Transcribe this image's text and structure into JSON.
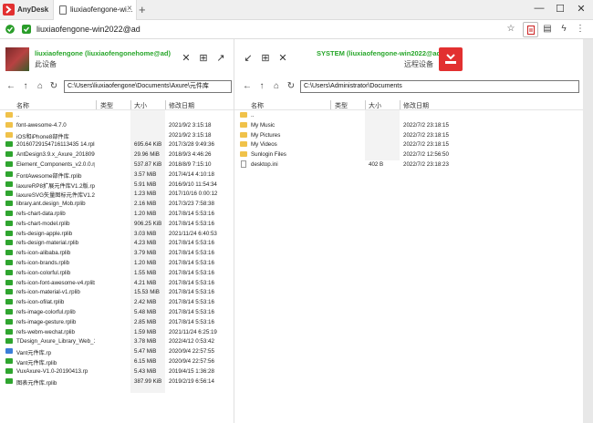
{
  "app": {
    "name": "AnyDesk",
    "tab_title": "liuxiaofengone-wi..."
  },
  "addressbar": {
    "address": "liuxiaofengone-win2022@ad"
  },
  "local": {
    "name": "liuxiaofengone (liuxiaofengonehome@ad)",
    "sub": "此设备",
    "path": "C:\\Users\\liuxiaofengone\\Documents\\Axure\\元件库",
    "columns": {
      "name": "名称",
      "type": "类型",
      "size": "大小",
      "date": "修改日期"
    },
    "rows": [
      {
        "icon": "folder",
        "name": "..",
        "size": "",
        "date": ""
      },
      {
        "icon": "folder",
        "name": "font-awesome-4.7.0",
        "size": "",
        "date": "2021/9/2 3:15:18"
      },
      {
        "icon": "folder",
        "name": "iOS和iPhone8部件库",
        "size": "",
        "date": "2021/9/2 3:15:18"
      },
      {
        "icon": "rplib",
        "name": "20160729154716113435 14.rplib",
        "size": "695.64 KiB",
        "date": "2017/3/28 9:49:36"
      },
      {
        "icon": "rplib",
        "name": "AntDesign3.9.x_Axure_20180903.rplib",
        "size": "29.96 MiB",
        "date": "2018/9/3 4:46:26"
      },
      {
        "icon": "rplib",
        "name": "Element_Components_v2.0.0.rplib",
        "size": "537.87 KiB",
        "date": "2018/8/9 7:15:10"
      },
      {
        "icon": "rplib",
        "name": "FontAwesome部件库.rplib",
        "size": "3.57 MiB",
        "date": "2017/4/14 4:10:18"
      },
      {
        "icon": "rplib",
        "name": "laxureRP8扩展元件库V1.2版.rplib",
        "size": "5.91 MiB",
        "date": "2016/9/10 11:54:34"
      },
      {
        "icon": "rplib",
        "name": "laxureSVG矢量图标元件库V1.21版.rplib",
        "size": "1.23 MiB",
        "date": "2017/10/16 0:00:12"
      },
      {
        "icon": "rplib",
        "name": "library.ant.design_Mob.rplib",
        "size": "2.16 MiB",
        "date": "2017/3/23 7:58:38"
      },
      {
        "icon": "rplib",
        "name": "refs-chart-data.rplib",
        "size": "1.20 MiB",
        "date": "2017/8/14 5:53:16"
      },
      {
        "icon": "rplib",
        "name": "refs-chart-model.rplib",
        "size": "906.25 KiB",
        "date": "2017/8/14 5:53:16"
      },
      {
        "icon": "rplib",
        "name": "refs-design-apple.rplib",
        "size": "3.03 MiB",
        "date": "2021/11/24 6:40:53"
      },
      {
        "icon": "rplib",
        "name": "refs-design-material.rplib",
        "size": "4.23 MiB",
        "date": "2017/8/14 5:53:16"
      },
      {
        "icon": "rplib",
        "name": "refs-icon-alibaba.rplib",
        "size": "3.79 MiB",
        "date": "2017/8/14 5:53:16"
      },
      {
        "icon": "rplib",
        "name": "refs-icon-brands.rplib",
        "size": "1.20 MiB",
        "date": "2017/8/14 5:53:16"
      },
      {
        "icon": "rplib",
        "name": "refs-icon-colorful.rplib",
        "size": "1.55 MiB",
        "date": "2017/8/14 5:53:16"
      },
      {
        "icon": "rplib",
        "name": "refs-icon-font-awesome-v4.rplib",
        "size": "4.21 MiB",
        "date": "2017/8/14 5:53:16"
      },
      {
        "icon": "rplib",
        "name": "refs-icon-material-v1.rplib",
        "size": "15.53 MiB",
        "date": "2017/8/14 5:53:16"
      },
      {
        "icon": "rplib",
        "name": "refs-icon-ofilat.rplib",
        "size": "2.42 MiB",
        "date": "2017/8/14 5:53:16"
      },
      {
        "icon": "rplib",
        "name": "refs-image-colorful.rplib",
        "size": "5.48 MiB",
        "date": "2017/8/14 5:53:16"
      },
      {
        "icon": "rplib",
        "name": "refs-image-gesture.rplib",
        "size": "2.85 MiB",
        "date": "2017/8/14 5:53:16"
      },
      {
        "icon": "rplib",
        "name": "refs-webm-wechat.rplib",
        "size": "1.59 MiB",
        "date": "2021/11/24 6:25:19"
      },
      {
        "icon": "rplib",
        "name": "TDesign_Axure_Library_Web_1.0.3.rplib",
        "size": "3.78 MiB",
        "date": "2022/4/12 0:53:42"
      },
      {
        "icon": "rp",
        "name": "Vant元件库.rp",
        "size": "5.47 MiB",
        "date": "2020/9/4 22:57:55"
      },
      {
        "icon": "rplib",
        "name": "Vant元件库.rplib",
        "size": "6.15 MiB",
        "date": "2020/9/4 22:57:56"
      },
      {
        "icon": "rplib",
        "name": "VuxAxure-V1.0-20190413.rp",
        "size": "5.43 MiB",
        "date": "2019/4/15 1:36:28"
      },
      {
        "icon": "rplib",
        "name": "图表元件库.rplib",
        "size": "387.99 KiB",
        "date": "2019/2/19 6:56:14"
      }
    ]
  },
  "remote": {
    "name": "SYSTEM (liuxiaofengone-win2022@ad)",
    "sub": "远程设备",
    "path": "C:\\Users\\Administrator\\Documents",
    "columns": {
      "name": "名称",
      "type": "类型",
      "size": "大小",
      "date": "修改日期"
    },
    "rows": [
      {
        "icon": "folder",
        "name": "..",
        "size": "",
        "date": ""
      },
      {
        "icon": "folder",
        "name": "My Music",
        "size": "",
        "date": "2022/7/2 23:18:15"
      },
      {
        "icon": "folder",
        "name": "My Pictures",
        "size": "",
        "date": "2022/7/2 23:18:15"
      },
      {
        "icon": "folder",
        "name": "My Videos",
        "size": "",
        "date": "2022/7/2 23:18:15"
      },
      {
        "icon": "folder",
        "name": "Sunlogin Files",
        "size": "",
        "date": "2022/7/2 12:56:50"
      },
      {
        "icon": "file",
        "name": "desktop.ini",
        "size": "402 B",
        "date": "2022/7/2 23:18:23"
      }
    ]
  },
  "colors": {
    "accent_green": "#27a62a",
    "anydesk_red": "#e23030",
    "folder": "#f0c24a"
  }
}
